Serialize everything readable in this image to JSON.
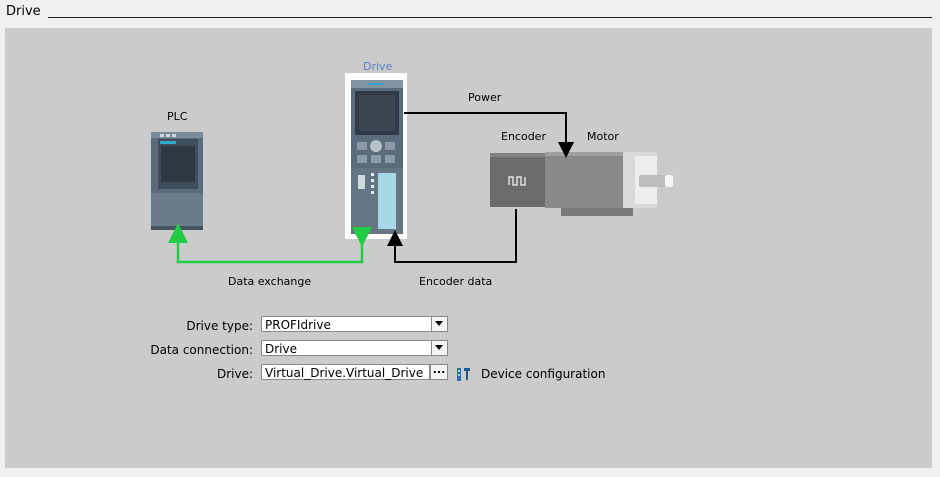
{
  "section": {
    "title": "Drive"
  },
  "diagram": {
    "plc_label": "PLC",
    "drive_label": "Drive",
    "power_label": "Power",
    "encoder_label": "Encoder",
    "motor_label": "Motor",
    "data_exchange_label": "Data exchange",
    "encoder_data_label": "Encoder data",
    "colors": {
      "data_exchange_line": "#22cc44",
      "power_line": "#000000",
      "drive_title": "#5b7fc4",
      "panel_bg": "#cbcbcb"
    }
  },
  "form": {
    "drive_type": {
      "label": "Drive type:",
      "value": "PROFIdrive"
    },
    "data_connection": {
      "label": "Data connection:",
      "value": "Drive"
    },
    "drive": {
      "label": "Drive:",
      "value": "Virtual_Drive.Virtual_Drive",
      "browse_label": "..."
    },
    "device_configuration_label": "Device configuration"
  }
}
